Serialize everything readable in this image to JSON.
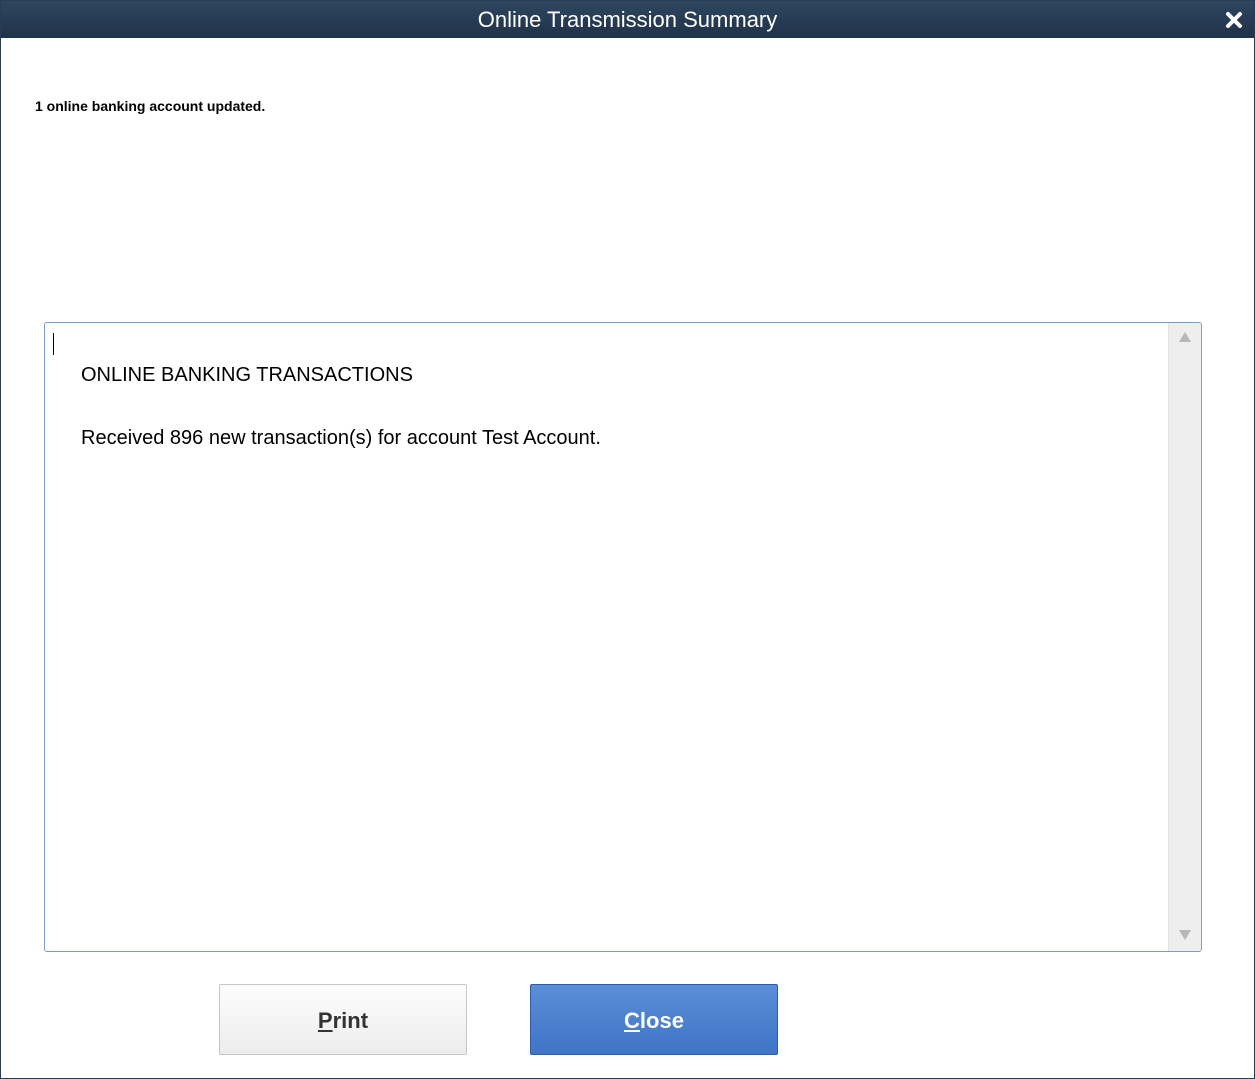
{
  "window": {
    "title": "Online Transmission Summary",
    "close_icon": "close-icon"
  },
  "status_message": "1 online banking account updated.",
  "summary": {
    "lines": [
      "ONLINE BANKING TRANSACTIONS",
      "Received 896 new transaction(s) for account Test Account."
    ]
  },
  "buttons": {
    "print": {
      "mnemonic": "P",
      "rest": "rint"
    },
    "close": {
      "mnemonic": "C",
      "rest": "lose"
    }
  },
  "colors": {
    "titlebar": "#263b52",
    "primary_button": "#4a80cf"
  }
}
